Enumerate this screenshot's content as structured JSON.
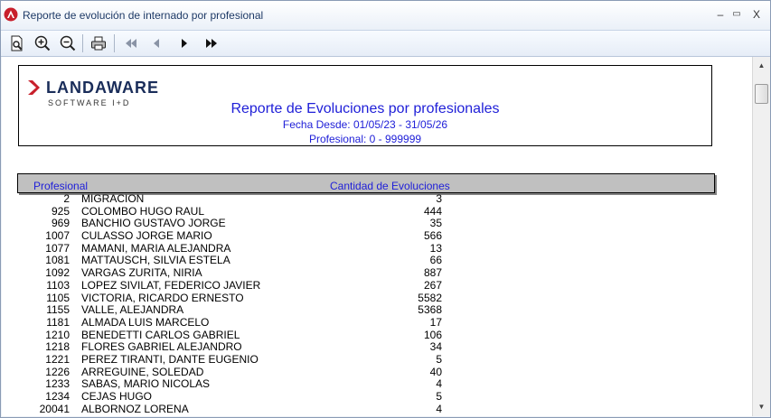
{
  "window": {
    "title": "Reporte de evolución de internado por profesional",
    "minimize": "–",
    "maximize": "▭",
    "close": "X"
  },
  "toolbar": {
    "items": [
      "preview-icon",
      "zoom-in-icon",
      "zoom-out-icon",
      "print-icon",
      "first-page-icon",
      "prev-page-icon",
      "next-page-icon",
      "last-page-icon"
    ]
  },
  "report": {
    "logo_main": "LANDAWARE",
    "logo_sub": "SOFTWARE I+D",
    "title": "Reporte de Evoluciones por profesionales",
    "date_range": "Fecha Desde: 01/05/23 - 31/05/26",
    "professional_range": "Profesional: 0 - 999999"
  },
  "table": {
    "headers": {
      "professional": "Profesional",
      "count": "Cantidad de Evoluciones"
    },
    "rows": [
      {
        "id": "2",
        "name": "MIGRACION",
        "count": "3"
      },
      {
        "id": "925",
        "name": "COLOMBO HUGO RAUL",
        "count": "444"
      },
      {
        "id": "969",
        "name": "BANCHIO GUSTAVO JORGE",
        "count": "35"
      },
      {
        "id": "1007",
        "name": "CULASSO JORGE MARIO",
        "count": "566"
      },
      {
        "id": "1077",
        "name": "MAMANI, MARIA ALEJANDRA",
        "count": "13"
      },
      {
        "id": "1081",
        "name": "MATTAUSCH, SILVIA ESTELA",
        "count": "66"
      },
      {
        "id": "1092",
        "name": "VARGAS ZURITA, NIRIA",
        "count": "887"
      },
      {
        "id": "1103",
        "name": "LOPEZ SIVILAT, FEDERICO JAVIER",
        "count": "267"
      },
      {
        "id": "1105",
        "name": "VICTORIA, RICARDO ERNESTO",
        "count": "5582"
      },
      {
        "id": "1155",
        "name": "VALLE, ALEJANDRA",
        "count": "5368"
      },
      {
        "id": "1181",
        "name": "ALMADA LUIS MARCELO",
        "count": "17"
      },
      {
        "id": "1210",
        "name": "BENEDETTI CARLOS GABRIEL",
        "count": "106"
      },
      {
        "id": "1218",
        "name": "FLORES GABRIEL ALEJANDRO",
        "count": "34"
      },
      {
        "id": "1221",
        "name": "PEREZ TIRANTI, DANTE EUGENIO",
        "count": "5"
      },
      {
        "id": "1226",
        "name": "ARREGUINE, SOLEDAD",
        "count": "40"
      },
      {
        "id": "1233",
        "name": "SABAS, MARIO NICOLAS",
        "count": "4"
      },
      {
        "id": "1234",
        "name": "CEJAS HUGO",
        "count": "5"
      },
      {
        "id": "20041",
        "name": "ALBORNOZ LORENA",
        "count": "4"
      }
    ]
  },
  "colors": {
    "report_blue": "#2020d8",
    "header_gray": "#c0c0c0",
    "logo_red": "#c8202c",
    "logo_navy": "#1a2d5a"
  }
}
